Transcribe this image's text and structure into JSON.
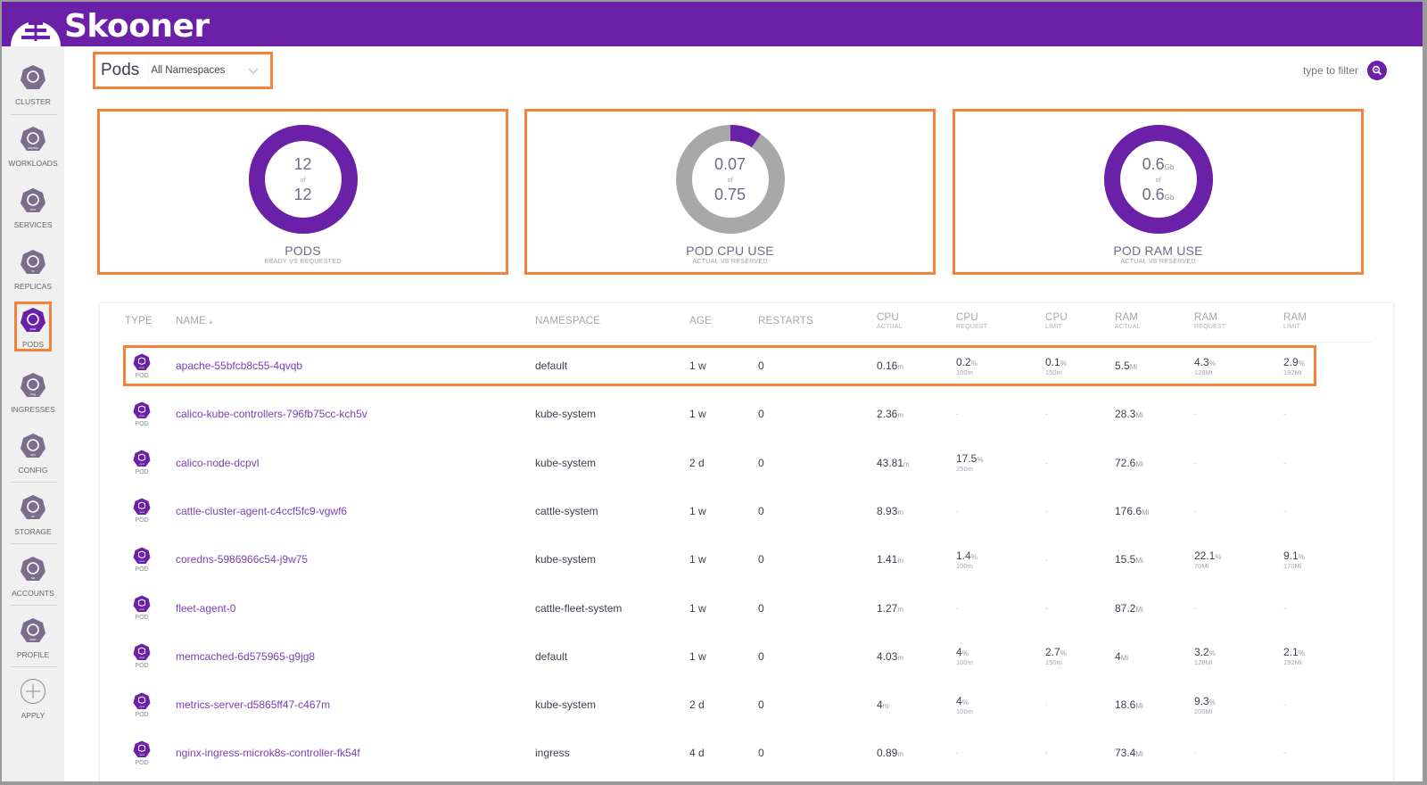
{
  "app": {
    "name": "Skooner",
    "brand_color": "#6b20a8",
    "highlight_color": "#f5823a"
  },
  "sidebar": {
    "items": [
      {
        "id": "cluster",
        "label": "CLUSTER",
        "icon": "helm-wheel-icon",
        "badge": ""
      },
      {
        "id": "workloads",
        "label": "WORKLOADS",
        "icon": "deploy-icon",
        "badge": "deploy"
      },
      {
        "id": "services",
        "label": "SERVICES",
        "icon": "svc-icon",
        "badge": "svc"
      },
      {
        "id": "replicas",
        "label": "REPLICAS",
        "icon": "rs-icon",
        "badge": "rs"
      },
      {
        "id": "pods",
        "label": "PODS",
        "icon": "pod-icon",
        "badge": "pod",
        "active": true
      },
      {
        "id": "ingresses",
        "label": "INGRESSES",
        "icon": "ing-icon",
        "badge": "ing"
      },
      {
        "id": "config",
        "label": "CONFIG",
        "icon": "cm-icon",
        "badge": "cm"
      },
      {
        "id": "storage",
        "label": "STORAGE",
        "icon": "sc-icon",
        "badge": "sc"
      },
      {
        "id": "accounts",
        "label": "ACCOUNTS",
        "icon": "sa-icon",
        "badge": "sa"
      },
      {
        "id": "profile",
        "label": "PROFILE",
        "icon": "user-icon",
        "badge": "user"
      },
      {
        "id": "apply",
        "label": "APPLY",
        "icon": "plus-circle-icon",
        "badge": ""
      }
    ]
  },
  "header": {
    "title": "Pods",
    "namespace_select": "All Namespaces",
    "filter_placeholder": "type to filter"
  },
  "summary": [
    {
      "big_top": "12",
      "unit_top": "",
      "of": "of",
      "big_bottom": "12",
      "unit_bottom": "",
      "title": "PODS",
      "subtitle": "READY VS REQUESTED",
      "actual": 12,
      "total": 12
    },
    {
      "big_top": "0.07",
      "unit_top": "",
      "of": "of",
      "big_bottom": "0.75",
      "unit_bottom": "",
      "title": "POD CPU USE",
      "subtitle": "ACTUAL VS RESERVED",
      "actual": 0.07,
      "total": 0.75
    },
    {
      "big_top": "0.6",
      "unit_top": "Gb",
      "of": "of",
      "big_bottom": "0.6",
      "unit_bottom": "Gb",
      "title": "POD RAM USE",
      "subtitle": "ACTUAL VS RESERVED",
      "actual": 0.6,
      "total": 0.6
    }
  ],
  "table": {
    "headers": {
      "type": "TYPE",
      "name": "NAME",
      "sort_indicator": "▴",
      "namespace": "NAMESPACE",
      "age": "AGE",
      "restarts": "RESTARTS",
      "cpu_actual": {
        "main": "CPU",
        "sub": "ACTUAL"
      },
      "cpu_request": {
        "main": "CPU",
        "sub": "REQUEST"
      },
      "cpu_limit": {
        "main": "CPU",
        "sub": "LIMIT"
      },
      "ram_actual": {
        "main": "RAM",
        "sub": "ACTUAL"
      },
      "ram_request": {
        "main": "RAM",
        "sub": "REQUEST"
      },
      "ram_limit": {
        "main": "RAM",
        "sub": "LIMIT"
      }
    },
    "type_label": "POD",
    "type_badge": "pod",
    "rows": [
      {
        "name": "apache-55bfcb8c55-4qvqb",
        "namespace": "default",
        "age": "1 w",
        "restarts": "0",
        "cpu_actual": {
          "v": "0.16",
          "u": "m"
        },
        "cpu_request": {
          "v": "0.2",
          "u": "%",
          "s": "100m"
        },
        "cpu_limit": {
          "v": "0.1",
          "u": "%",
          "s": "150m"
        },
        "ram_actual": {
          "v": "5.5",
          "u": "Mi"
        },
        "ram_request": {
          "v": "4.3",
          "u": "%",
          "s": "128Mi"
        },
        "ram_limit": {
          "v": "2.9",
          "u": "%",
          "s": "192Mi"
        },
        "highlighted": true
      },
      {
        "name": "calico-kube-controllers-796fb75cc-kch5v",
        "namespace": "kube-system",
        "age": "1 w",
        "restarts": "0",
        "cpu_actual": {
          "v": "2.36",
          "u": "m"
        },
        "cpu_request": {
          "v": "-"
        },
        "cpu_limit": {
          "v": "-"
        },
        "ram_actual": {
          "v": "28.3",
          "u": "Mi"
        },
        "ram_request": {
          "v": "-"
        },
        "ram_limit": {
          "v": "-"
        }
      },
      {
        "name": "calico-node-dcpvl",
        "namespace": "kube-system",
        "age": "2 d",
        "restarts": "0",
        "cpu_actual": {
          "v": "43.81",
          "u": "m"
        },
        "cpu_request": {
          "v": "17.5",
          "u": "%",
          "s": "250m"
        },
        "cpu_limit": {
          "v": "-"
        },
        "ram_actual": {
          "v": "72.6",
          "u": "Mi"
        },
        "ram_request": {
          "v": "-"
        },
        "ram_limit": {
          "v": "-"
        }
      },
      {
        "name": "cattle-cluster-agent-c4ccf5fc9-vgwf6",
        "namespace": "cattle-system",
        "age": "1 w",
        "restarts": "0",
        "cpu_actual": {
          "v": "8.93",
          "u": "m"
        },
        "cpu_request": {
          "v": "-"
        },
        "cpu_limit": {
          "v": "-"
        },
        "ram_actual": {
          "v": "176.6",
          "u": "Mi"
        },
        "ram_request": {
          "v": "-"
        },
        "ram_limit": {
          "v": "-"
        }
      },
      {
        "name": "coredns-5986966c54-j9w75",
        "namespace": "kube-system",
        "age": "1 w",
        "restarts": "0",
        "cpu_actual": {
          "v": "1.41",
          "u": "m"
        },
        "cpu_request": {
          "v": "1.4",
          "u": "%",
          "s": "100m"
        },
        "cpu_limit": {
          "v": "-"
        },
        "ram_actual": {
          "v": "15.5",
          "u": "Mi"
        },
        "ram_request": {
          "v": "22.1",
          "u": "%",
          "s": "70Mi"
        },
        "ram_limit": {
          "v": "9.1",
          "u": "%",
          "s": "170Mi"
        }
      },
      {
        "name": "fleet-agent-0",
        "namespace": "cattle-fleet-system",
        "age": "1 w",
        "restarts": "0",
        "cpu_actual": {
          "v": "1.27",
          "u": "m"
        },
        "cpu_request": {
          "v": "-"
        },
        "cpu_limit": {
          "v": "-"
        },
        "ram_actual": {
          "v": "87.2",
          "u": "Mi"
        },
        "ram_request": {
          "v": "-"
        },
        "ram_limit": {
          "v": "-"
        }
      },
      {
        "name": "memcached-6d575965-g9jg8",
        "namespace": "default",
        "age": "1 w",
        "restarts": "0",
        "cpu_actual": {
          "v": "4.03",
          "u": "m"
        },
        "cpu_request": {
          "v": "4",
          "u": "%",
          "s": "100m"
        },
        "cpu_limit": {
          "v": "2.7",
          "u": "%",
          "s": "150m"
        },
        "ram_actual": {
          "v": "4",
          "u": "Mi"
        },
        "ram_request": {
          "v": "3.2",
          "u": "%",
          "s": "128Mi"
        },
        "ram_limit": {
          "v": "2.1",
          "u": "%",
          "s": "192Mi"
        }
      },
      {
        "name": "metrics-server-d5865ff47-c467m",
        "namespace": "kube-system",
        "age": "2 d",
        "restarts": "0",
        "cpu_actual": {
          "v": "4",
          "u": "m"
        },
        "cpu_request": {
          "v": "4",
          "u": "%",
          "s": "100m"
        },
        "cpu_limit": {
          "v": "-"
        },
        "ram_actual": {
          "v": "18.6",
          "u": "Mi"
        },
        "ram_request": {
          "v": "9.3",
          "u": "%",
          "s": "200Mi"
        },
        "ram_limit": {
          "v": "-"
        }
      },
      {
        "name": "nginx-ingress-microk8s-controller-fk54f",
        "namespace": "ingress",
        "age": "4 d",
        "restarts": "0",
        "cpu_actual": {
          "v": "0.89",
          "u": "m"
        },
        "cpu_request": {
          "v": "-"
        },
        "cpu_limit": {
          "v": "-"
        },
        "ram_actual": {
          "v": "73.4",
          "u": "Mi"
        },
        "ram_request": {
          "v": "-"
        },
        "ram_limit": {
          "v": "-"
        }
      }
    ]
  }
}
